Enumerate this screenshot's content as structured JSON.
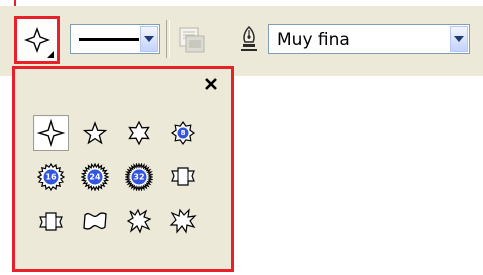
{
  "toolbar": {
    "outline_width_field": {
      "line_style": "solid-thin"
    },
    "font_select": {
      "value": "Muy fina"
    },
    "icons": {
      "shape_tool": "four-point-star-icon",
      "disabled_tool": "page-stack-icon",
      "pen_tool": "pen-nib-icon"
    }
  },
  "shape_popup": {
    "close_icon": "close-icon",
    "selected_index": 0,
    "shapes": [
      {
        "name": "four-point-star-icon"
      },
      {
        "name": "five-point-star-icon"
      },
      {
        "name": "six-point-star-icon"
      },
      {
        "name": "seal-8-icon",
        "label": "8"
      },
      {
        "name": "seal-16-icon",
        "label": "16"
      },
      {
        "name": "seal-24-icon",
        "label": "24"
      },
      {
        "name": "seal-32-icon",
        "label": "32"
      },
      {
        "name": "ribbon-up-icon"
      },
      {
        "name": "ribbon-down-icon"
      },
      {
        "name": "wave-icon"
      },
      {
        "name": "explosion-1-icon"
      },
      {
        "name": "explosion-2-icon"
      }
    ]
  },
  "colors": {
    "highlight_border": "#e8202a",
    "toolbar_bg": "#ece9d8",
    "seal_fill": "#3355dd"
  }
}
